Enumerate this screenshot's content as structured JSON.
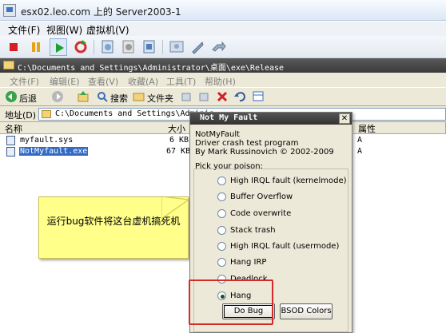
{
  "console": {
    "title": "esx02.leo.com 上的 Server2003-1",
    "menu": [
      "文件(F)",
      "视图(W)",
      "虚拟机(V)"
    ]
  },
  "explorer": {
    "title": "C:\\Documents and Settings\\Administrator\\桌面\\exe\\Release",
    "menu": [
      "文件(F)",
      "编辑(E)",
      "查看(V)",
      "收藏(A)",
      "工具(T)",
      "帮助(H)"
    ],
    "back_label": "后退",
    "search_label": "搜索",
    "folders_label": "文件夹",
    "address_label": "地址(D)",
    "address_value": "C:\\Documents and Settings\\Adminis",
    "columns": {
      "name": "名称",
      "size": "大小",
      "attr": "属性"
    },
    "files": [
      {
        "name": "myfault.sys",
        "size": "6 KB",
        "attr": "A"
      },
      {
        "name": "NotMyfault.exe",
        "size": "67 KB",
        "attr": "A"
      }
    ]
  },
  "note": {
    "text": "运行bug软件将这台虚机搞死机"
  },
  "dialog": {
    "title": "Not My Fault",
    "close": "✕",
    "app": "NotMyFault",
    "desc": "Driver crash test program",
    "author": "By Mark Russinovich © 2002-2009",
    "pick": "Pick your poison:",
    "options": [
      "High IRQL fault (kernelmode)",
      "Buffer Overflow",
      "Code overwrite",
      "Stack trash",
      "High IRQL fault (usermode)",
      "Hang IRP",
      "Deadlock",
      "Hang"
    ],
    "selected_index": 7,
    "do_bug": "Do Bug",
    "bsod_colors": "BSOD Colors"
  }
}
